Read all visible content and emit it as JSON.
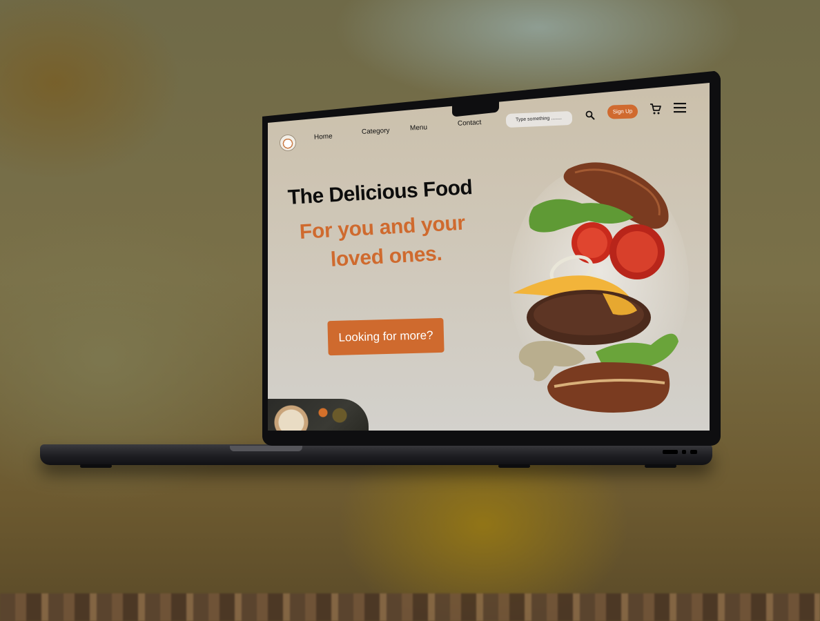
{
  "site": {
    "nav": {
      "home": "Home",
      "category": "Category",
      "menu": "Menu",
      "contact": "Contact"
    },
    "search": {
      "placeholder": "Type something ........"
    },
    "signup_label": "Sign Up",
    "icons": [
      "logo",
      "search-icon",
      "cart-icon",
      "hamburger-menu-icon"
    ],
    "hero": {
      "title": "The Delicious Food",
      "subtitle_line1": "For  you and your",
      "subtitle_line2": "loved ones.",
      "cta_label": "Looking for more?"
    },
    "colors": {
      "accent": "#cf6a2e",
      "background": "#cfc7b8",
      "text": "#0d0d0d"
    }
  }
}
